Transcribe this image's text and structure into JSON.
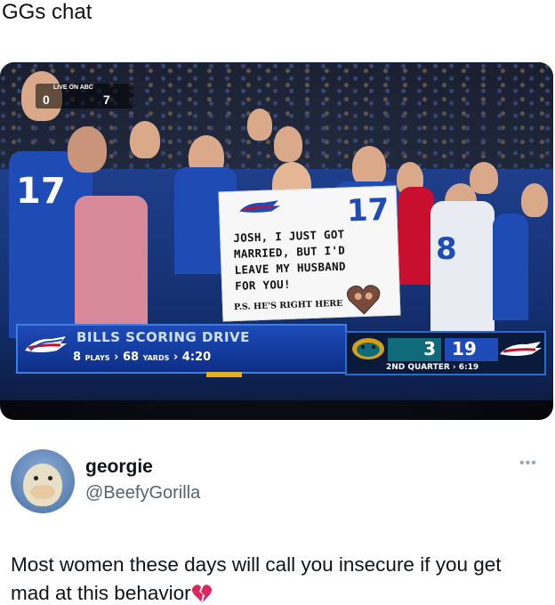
{
  "header": {
    "title": "GGs chat"
  },
  "media": {
    "live_bug": {
      "network": "LIVE ON ABC",
      "score_left": "0",
      "score_right": "7"
    },
    "sign": {
      "number": "17",
      "lines": [
        "JOSH, I JUST GOT",
        "MARRIED, BUT I'D",
        "LEAVE MY HUSBAND",
        "FOR YOU!"
      ],
      "postscript": "P.S. HE'S RIGHT HERE"
    },
    "jersey_numbers": {
      "left_fan": "17",
      "right_fan": "8"
    },
    "banner": {
      "title": "BILLS SCORING DRIVE",
      "plays_value": "8",
      "plays_label": "PLAYS",
      "yards_value": "68",
      "yards_label": "YARDS",
      "time": "4:20"
    },
    "scoreboard": {
      "jaguars_score": "3",
      "bills_score": "19",
      "quarter": "2ND QUARTER",
      "clock": "6:19"
    }
  },
  "post": {
    "name": "georgie",
    "handle": "@BeefyGorilla",
    "more": "•••",
    "text": "Most women these days will call you insecure if you get mad at this behavior"
  },
  "colors": {
    "bills_blue": "#1e4bb8",
    "bills_red": "#c8102e",
    "jaguars_teal": "#0f6a7a",
    "handle_gray": "#536471"
  },
  "icons": [
    "bills-logo-icon",
    "jaguars-logo-icon",
    "broken-heart-icon",
    "more-options-icon",
    "heart-photo-icon"
  ]
}
